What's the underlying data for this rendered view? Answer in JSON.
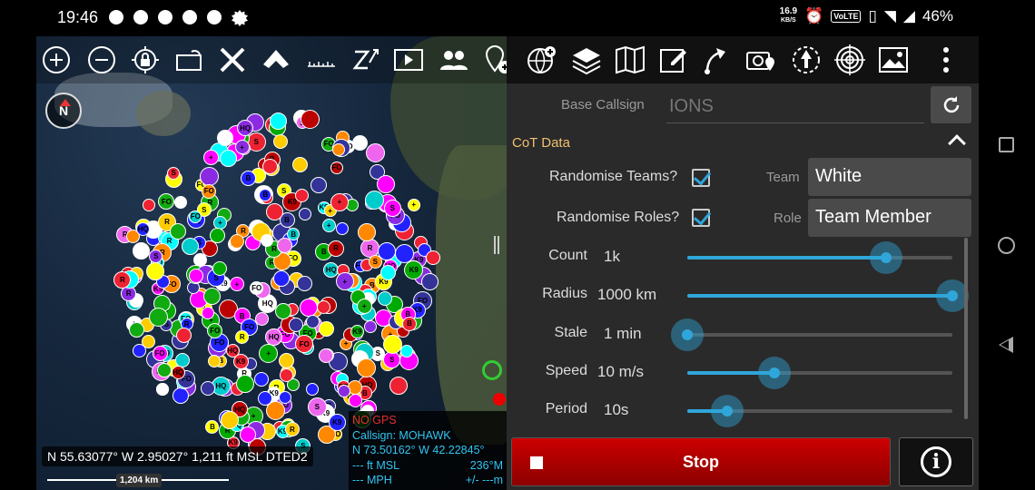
{
  "status_bar": {
    "time": "19:46",
    "net_speed": "16.9",
    "net_unit": "KB/S",
    "volte": "VoLTE",
    "battery": "46%"
  },
  "map": {
    "compass_label": "N",
    "coordinates": "N 55.63077°  W 2.95027°  1,211 ft MSL  DTED2",
    "scale_label": "1,204 km",
    "marker_labels": [
      "R",
      "FO",
      "HQ",
      "K9",
      "S",
      "+",
      "B"
    ],
    "info": {
      "no_gps": "NO GPS",
      "callsign": "Callsign: MOHAWK",
      "position": "N 73.50162°  W 42.22845°",
      "altitude": "--- ft MSL",
      "heading": "236°M",
      "speed": "--- MPH",
      "accuracy": "+/- ---m"
    },
    "toolbar_icons": [
      "zoom-in-icon",
      "zoom-out-icon",
      "lock-location-icon",
      "rotate-icon",
      "close-x-icon",
      "mask-icon",
      "ruler-icon",
      "z-bearing-icon",
      "play-icon",
      "team-icon",
      "add-pin-icon"
    ]
  },
  "right_toolbar_icons": [
    "globe-add-icon",
    "layers-icon",
    "map-icon",
    "edit-icon",
    "route-icon",
    "camera-location-icon",
    "compass-arrow-icon",
    "target-icon",
    "image-icon",
    "more-vert-icon"
  ],
  "panel": {
    "base_callsign_label": "Base Callsign",
    "base_callsign_value": "IONS",
    "section_title": "CoT Data",
    "randomise_teams_label": "Randomise Teams?",
    "team_label": "Team",
    "team_value": "White",
    "randomise_roles_label": "Randomise Roles?",
    "role_label": "Role",
    "role_value": "Team Member",
    "sliders": [
      {
        "label": "Count",
        "value": "1k",
        "level": 0.75
      },
      {
        "label": "Radius",
        "value": "1000 km",
        "level": 1.0
      },
      {
        "label": "Stale",
        "value": "1 min",
        "level": 0.0
      },
      {
        "label": "Speed",
        "value": "10 m/s",
        "level": 0.33
      },
      {
        "label": "Period",
        "value": "10s",
        "level": 0.15
      }
    ],
    "stop_label": "Stop"
  },
  "colors": {
    "accent": "#2fa6d9",
    "stop": "#cc0000",
    "section": "#f0c070",
    "no_gps": "#e03030",
    "info_text": "#33c4f0"
  }
}
